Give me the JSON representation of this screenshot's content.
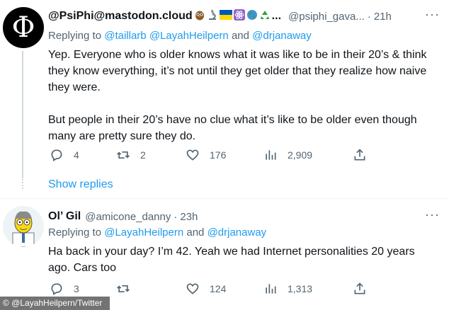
{
  "tweet1": {
    "display_name": "@PsiPhi@mastodon.cloud",
    "name_suffix": "...",
    "handle": "@psiphi_gava...",
    "time_sep": "·",
    "time": "21h",
    "replying_label": "Replying to",
    "reply_users": [
      "@taillarb",
      "@LayahHeilpern",
      "@drjanaway"
    ],
    "and_word": "and",
    "paragraph1": "Yep. Everyone who is older knows what it was like to be  in their 20’s & think they know everything, it’s not until they get older that they realize how naive they were.",
    "paragraph2": "But people in their 20’s have no clue what it’s like to be older even though many are pretty sure they do.",
    "replies": "4",
    "retweets": "2",
    "likes": "176",
    "views": "2,909",
    "show_replies": "Show replies"
  },
  "tweet2": {
    "display_name": "Ol’ Gil",
    "handle": "@amicone_danny",
    "time_sep": "·",
    "time": "23h",
    "replying_label": "Replying to",
    "reply_users": [
      "@LayahHeilpern",
      "@drjanaway"
    ],
    "and_word": "and",
    "text": "Ha back in your day? I’m 42. Yeah we had Internet personalities 20 years ago. Cars too",
    "replies": "3",
    "retweets": "",
    "likes": "124",
    "views": "1,313"
  },
  "credit": "© @LayahHeilpern/Twitter",
  "colors": {
    "accent": "#1d9bf0",
    "muted": "#536471",
    "text": "#0f1419"
  },
  "icons": [
    "phi-logo-avatar",
    "owl-emoji",
    "microscope-emoji",
    "ukraine-flag-emoji",
    "atom-emoji",
    "globe-emoji",
    "recycle-emoji",
    "cartoon-avatar"
  ]
}
